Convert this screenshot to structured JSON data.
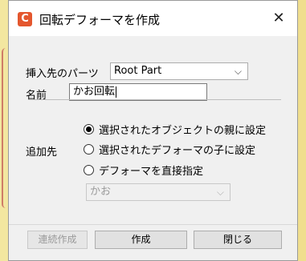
{
  "dialog": {
    "title": "回転デフォーマを作成",
    "close_glyph": "✕",
    "app_icon_glyph": "C"
  },
  "form": {
    "parent_label": "挿入先のパーツ",
    "parent_value": "Root Part",
    "name_label": "名前",
    "name_value": "かお回転",
    "add_to_label": "追加先",
    "options": [
      {
        "label": "選択されたオブジェクトの親に設定",
        "selected": true
      },
      {
        "label": "選択されたデフォーマの子に設定",
        "selected": false
      },
      {
        "label": "デフォーマを直接指定",
        "selected": false
      }
    ],
    "direct_select_value": "かお"
  },
  "buttons": {
    "continuous": "連続作成",
    "create": "作成",
    "close": "閉じる"
  },
  "icons": {
    "dropdown": "chevron-down-icon"
  }
}
